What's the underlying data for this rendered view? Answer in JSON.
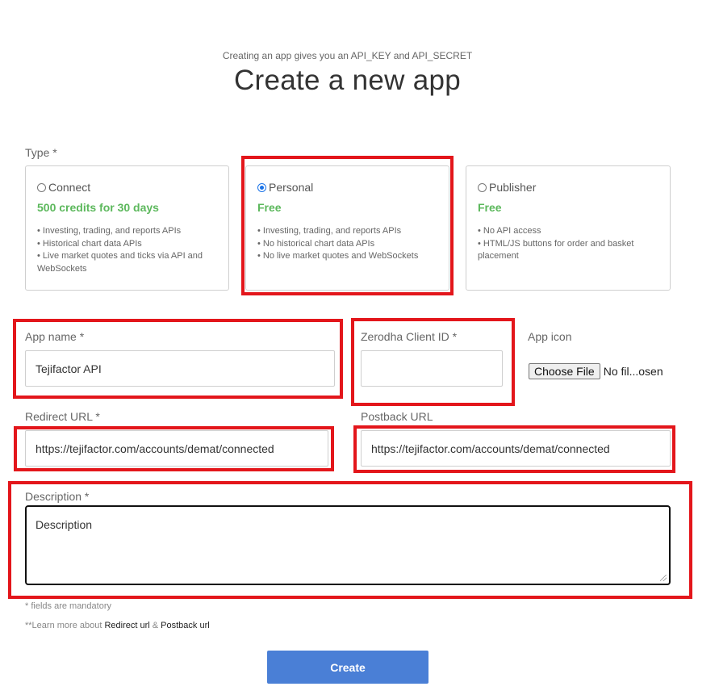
{
  "header": {
    "subtitle": "Creating an app gives you an API_KEY and API_SECRET",
    "title": "Create a new app"
  },
  "type": {
    "label": "Type *",
    "selected": "Personal",
    "options": [
      {
        "name": "Connect",
        "price": "500 credits for 30 days",
        "features": [
          "Investing, trading, and reports APIs",
          "Historical chart data APIs",
          "Live market quotes and ticks via API and WebSockets"
        ]
      },
      {
        "name": "Personal",
        "price": "Free",
        "features": [
          "Investing, trading, and reports APIs",
          "No historical chart data APIs",
          "No live market quotes and WebSockets"
        ]
      },
      {
        "name": "Publisher",
        "price": "Free",
        "features": [
          "No API access",
          "HTML/JS buttons for order and basket placement"
        ]
      }
    ]
  },
  "fields": {
    "app_name": {
      "label": "App name *",
      "value": "Tejifactor API"
    },
    "client_id": {
      "label": "Zerodha Client ID *",
      "value": ""
    },
    "app_icon": {
      "label": "App icon",
      "button": "Choose File",
      "status": "No fil...osen"
    },
    "redirect_url": {
      "label": "Redirect URL *",
      "value": "https://tejifactor.com/accounts/demat/connected"
    },
    "postback_url": {
      "label": "Postback URL",
      "value": "https://tejifactor.com/accounts/demat/connected"
    },
    "description": {
      "label": "Description *",
      "placeholder": "Description"
    }
  },
  "notes": {
    "mandatory": "* fields are mandatory",
    "learn_prefix": "**Learn more about ",
    "redirect_link": "Redirect url",
    "amp": " & ",
    "postback_link": "Postback url"
  },
  "actions": {
    "create_label": "Create"
  },
  "colors": {
    "accent": "#4a7fd6",
    "price_green": "#5cb85c",
    "highlight_red": "#e3161b"
  }
}
